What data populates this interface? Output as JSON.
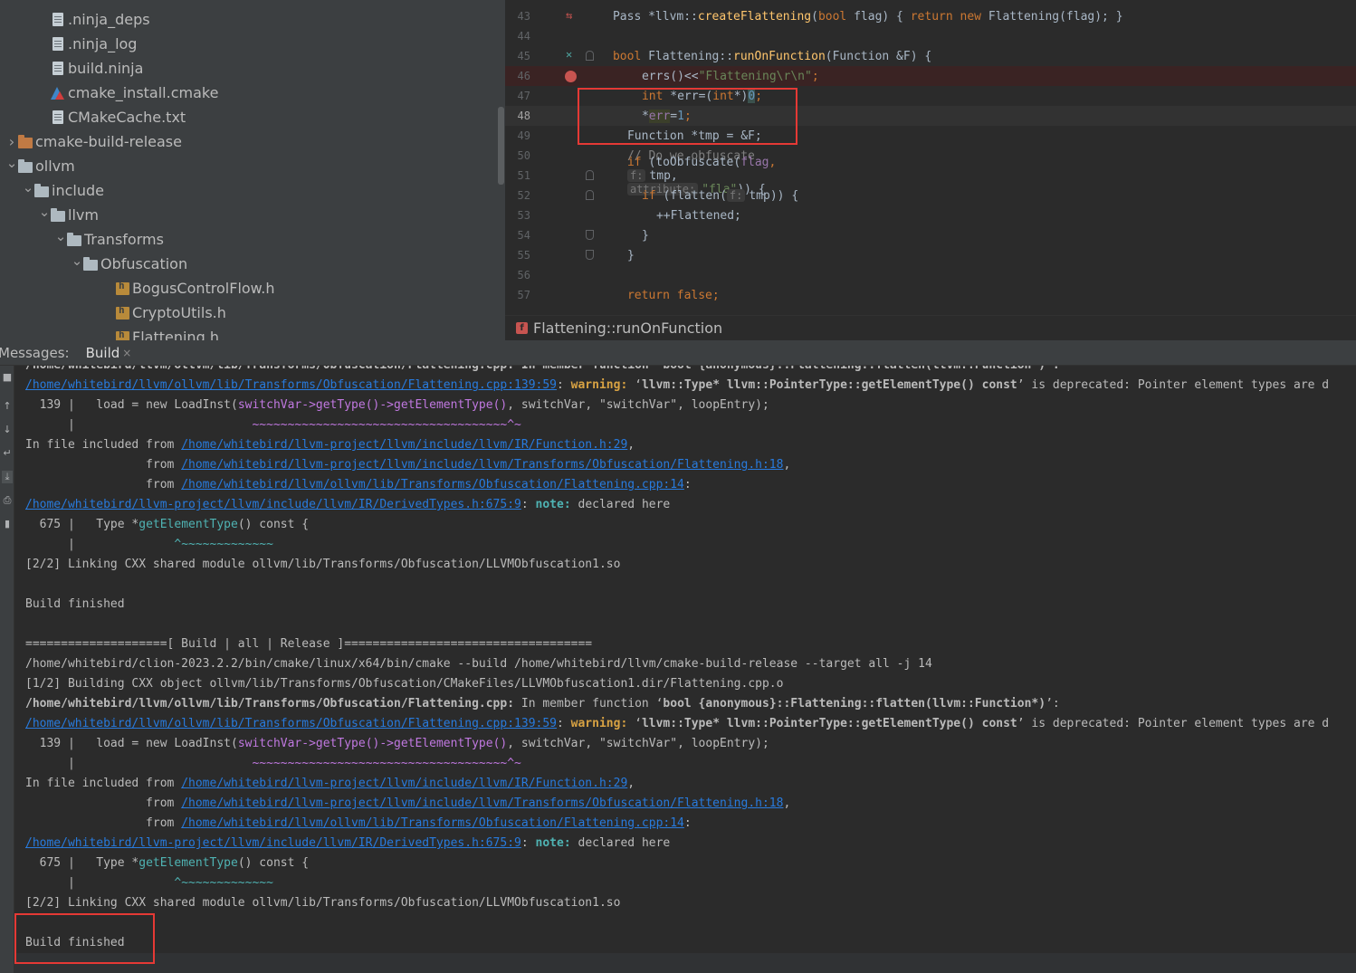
{
  "tree": {
    "items": [
      {
        "label": ".ninja_deps",
        "icon": "ninja-file-icon",
        "indent": 3,
        "arrow": ""
      },
      {
        "label": ".ninja_log",
        "icon": "ninja-file-icon",
        "indent": 3,
        "arrow": ""
      },
      {
        "label": "build.ninja",
        "icon": "ninja-file-icon",
        "indent": 3,
        "arrow": ""
      },
      {
        "label": "cmake_install.cmake",
        "icon": "cmake-icon",
        "indent": 3,
        "arrow": ""
      },
      {
        "label": "CMakeCache.txt",
        "icon": "text-file-icon",
        "indent": 3,
        "arrow": ""
      },
      {
        "label": "cmake-build-release",
        "icon": "folder-orange-icon",
        "indent": 1,
        "arrow": "collapsed"
      },
      {
        "label": "ollvm",
        "icon": "folder-icon",
        "indent": 1,
        "arrow": "expanded"
      },
      {
        "label": "include",
        "icon": "folder-icon",
        "indent": 2,
        "arrow": "expanded"
      },
      {
        "label": "llvm",
        "icon": "folder-icon",
        "indent": 3,
        "arrow": "expanded"
      },
      {
        "label": "Transforms",
        "icon": "folder-icon",
        "indent": 4,
        "arrow": "expanded"
      },
      {
        "label": "Obfuscation",
        "icon": "folder-icon",
        "indent": 5,
        "arrow": "expanded"
      },
      {
        "label": "BogusControlFlow.h",
        "icon": "header-file-icon",
        "indent": 7,
        "arrow": ""
      },
      {
        "label": "CryptoUtils.h",
        "icon": "header-file-icon",
        "indent": 7,
        "arrow": ""
      },
      {
        "label": "Flattening.h",
        "icon": "header-file-icon",
        "indent": 7,
        "arrow": ""
      }
    ]
  },
  "editor": {
    "lines": [
      {
        "num": "43",
        "gutter": "override-icon"
      },
      {
        "num": "44",
        "gutter": ""
      },
      {
        "num": "45",
        "gutter": "implemented-icon"
      },
      {
        "num": "46",
        "gutter": "breakpoint-icon"
      },
      {
        "num": "47",
        "gutter": ""
      },
      {
        "num": "48",
        "gutter": ""
      },
      {
        "num": "49",
        "gutter": ""
      },
      {
        "num": "50",
        "gutter": ""
      },
      {
        "num": "51",
        "gutter": "fold"
      },
      {
        "num": "52",
        "gutter": "fold"
      },
      {
        "num": "53",
        "gutter": ""
      },
      {
        "num": "54",
        "gutter": "fold-end"
      },
      {
        "num": "55",
        "gutter": "fold-end"
      },
      {
        "num": "56",
        "gutter": ""
      },
      {
        "num": "57",
        "gutter": ""
      }
    ],
    "code": {
      "l43": [
        "Pass *llvm::",
        "createFlattening",
        "(",
        "bool",
        " flag) { ",
        "return new",
        " Flattening(flag); }"
      ],
      "l45": [
        "bool",
        " Flattening::",
        "runOnFunction",
        "(Function &F) {"
      ],
      "l46": [
        "errs()<<",
        "\"Flattening\\r\\n\"",
        ";"
      ],
      "l47": [
        "int",
        " *err=(",
        "int",
        "*)",
        "0",
        ";"
      ],
      "l48": [
        "*",
        "err",
        "=",
        "1",
        ";"
      ],
      "l49": [
        "Function *tmp = &F;"
      ],
      "l50": [
        "// Do we obfuscate"
      ],
      "l51": [
        "if",
        " (toObfuscate(",
        "flag",
        ",",
        "f:",
        "tmp,",
        "attribute:",
        "\"fla\"",
        ")) {"
      ],
      "l52": [
        "if",
        " (flatten(",
        "f:",
        "tmp)) {"
      ],
      "l53": [
        "++Flattened;"
      ],
      "l54": [
        "}"
      ],
      "l55": [
        "}"
      ],
      "l57": [
        "return false",
        ";"
      ]
    },
    "breadcrumb": "Flattening::runOnFunction",
    "breadcrumb_icon": "f"
  },
  "messages": {
    "label": "Messages:",
    "tab": "Build",
    "close": "×"
  },
  "output": {
    "partial_top": "/home/whitebird/llvm/ollvm/lib/Transforms/Obfuscation/Flattening.cpp: In member function ‘bool {anonymous}::Flattening::flatten(llvm::Function*)’:",
    "warn_link": "/home/whitebird/llvm/ollvm/lib/Transforms/Obfuscation/Flattening.cpp:139:59",
    "warn_label": "warning:",
    "warn_text": " ‘llvm::Type* llvm::PointerType::getElementType() const’ is deprecated: Pointer element types are d",
    "l139_num": "  139 |",
    "l139_a": "   load = new LoadInst(",
    "l139_b": "switchVar->getType()->getElementType()",
    "l139_c": ", switchVar, \"switchVar\", loopEntry);",
    "l139_bar": "      |",
    "l139_tilde": "                         ~~~~~~~~~~~~~~~~~~~~~~~~~~~~~~~~~~~~^~",
    "incl_prefix": "In file included from ",
    "incl_link1": "/home/whitebird/llvm-project/llvm/include/llvm/IR/Function.h:29",
    "from_prefix": "                 from ",
    "incl_link2": "/home/whitebird/llvm-project/llvm/include/llvm/Transforms/Obfuscation/Flattening.h:18",
    "incl_link3": "/home/whitebird/llvm/ollvm/lib/Transforms/Obfuscation/Flattening.cpp:14",
    "note_link": "/home/whitebird/llvm-project/llvm/include/llvm/IR/DerivedTypes.h:675:9",
    "note_label": "note:",
    "note_text": " declared here",
    "l675_num": "  675 |",
    "l675_a": "   Type *",
    "l675_b": "getElementType",
    "l675_c": "() const {",
    "l675_bar": "      |",
    "l675_caret": "              ^~~~~~~~~~~~~~",
    "link_line": "[2/2] Linking CXX shared module ollvm/lib/Transforms/Obfuscation/LLVMObfuscation1.so",
    "build_finished": "Build finished",
    "banner": "====================[ Build | all | Release ]===================================",
    "cmd": "/home/whitebird/clion-2023.2.2/bin/cmake/linux/x64/bin/cmake --build /home/whitebird/llvm/cmake-build-release --target all -j 14",
    "building": "[1/2] Building CXX object ollvm/lib/Transforms/Obfuscation/CMakeFiles/LLVMObfuscation1.dir/Flattening.cpp.o",
    "in_member_file": "/home/whitebird/llvm/ollvm/lib/Transforms/Obfuscation/Flattening.cpp:",
    "in_member_a": " In member function ‘",
    "in_member_b": "bool {anonymous}::Flattening::flatten(llvm::Function*)",
    "in_member_c": "’:",
    "warn_text_a": " ‘",
    "warn_text_b": "llvm::Type* llvm::PointerType::getElementType() const",
    "warn_text_c": "’ is deprecated: Pointer element types are d"
  }
}
